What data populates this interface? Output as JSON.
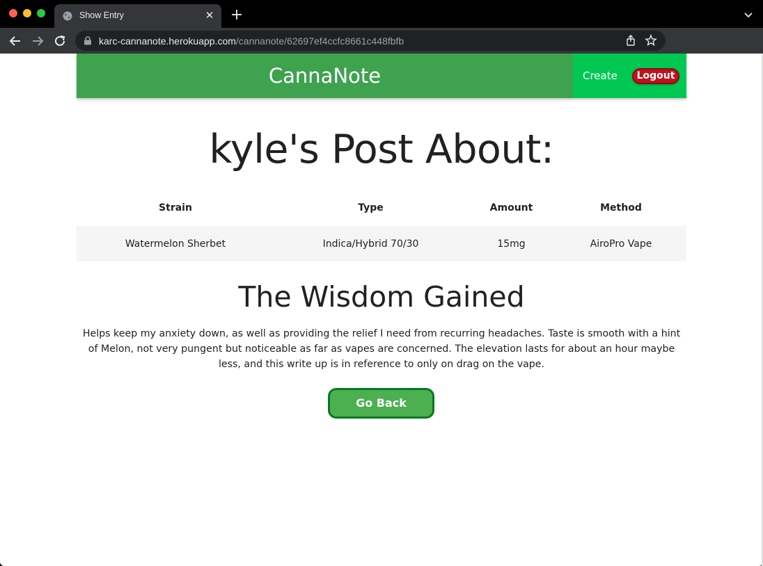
{
  "browser": {
    "tab_title": "Show Entry",
    "tab_close": "✕",
    "new_tab": "+",
    "url_host": "karc-cannanote.herokuapp.com",
    "url_path": "/cannanote/62697ef4ccfc8661c448fbfb"
  },
  "navbar": {
    "brand": "CannaNote",
    "create_label": "Create",
    "logout_label": "Logout",
    "colors": {
      "bar": "#3ea24f",
      "right": "#00c853",
      "logout": "#c1121f"
    }
  },
  "post": {
    "heading": "kyle's Post About:",
    "table": {
      "headers": [
        "Strain",
        "Type",
        "Amount",
        "Method"
      ],
      "row": [
        "Watermelon Sherbet",
        "Indica/Hybrid 70/30",
        "15mg",
        "AiroPro Vape"
      ]
    },
    "wisdom_heading": "The Wisdom Gained",
    "wisdom_body": "Helps keep my anxiety down, as well as providing the relief I need from recurring headaches. Taste is smooth with a hint of Melon, not very pungent but noticeable as far as vapes are concerned. The elevation lasts for about an hour maybe less, and this write up is in reference to only on drag on the vape.",
    "go_back_label": "Go Back"
  }
}
